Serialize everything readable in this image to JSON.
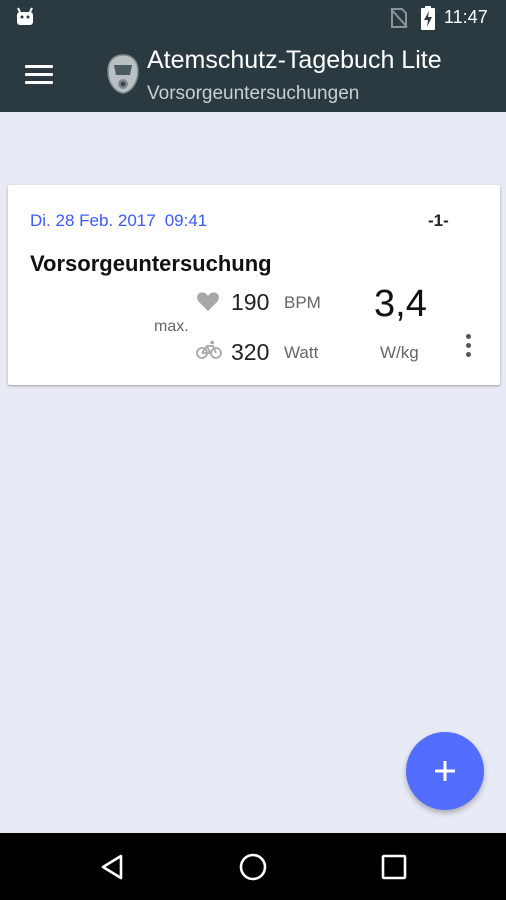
{
  "status_bar": {
    "time": "11:47",
    "icons": [
      "android-icon",
      "no-sim-icon",
      "battery-charging-icon"
    ]
  },
  "app_bar": {
    "title": "Atemschutz-Tagebuch Lite",
    "subtitle": "Vorsorgeuntersuchungen",
    "menu_icon": "hamburger-menu-icon",
    "logo_icon": "respirator-mask-icon"
  },
  "card": {
    "date": "Di. 28 Feb. 2017",
    "time": "09:41",
    "index": "-1-",
    "title": "Vorsorgeuntersuchung",
    "max_label": "max.",
    "pulse": {
      "icon": "heart-icon",
      "value": "190",
      "unit": "BPM"
    },
    "power": {
      "icon": "bicycle-icon",
      "value": "320",
      "unit": "Watt"
    },
    "ratio": {
      "value": "3,4",
      "unit": "W/kg"
    },
    "overflow_icon": "more-vert-icon"
  },
  "fab": {
    "icon": "plus-icon",
    "label": "+"
  },
  "nav_bar": {
    "icons": [
      "back-icon",
      "home-icon",
      "recents-icon"
    ]
  },
  "colors": {
    "app_bar": "#2b3a40",
    "background": "#e8eaf6",
    "accent": "#536dfe",
    "date_text": "#3d5afe"
  }
}
